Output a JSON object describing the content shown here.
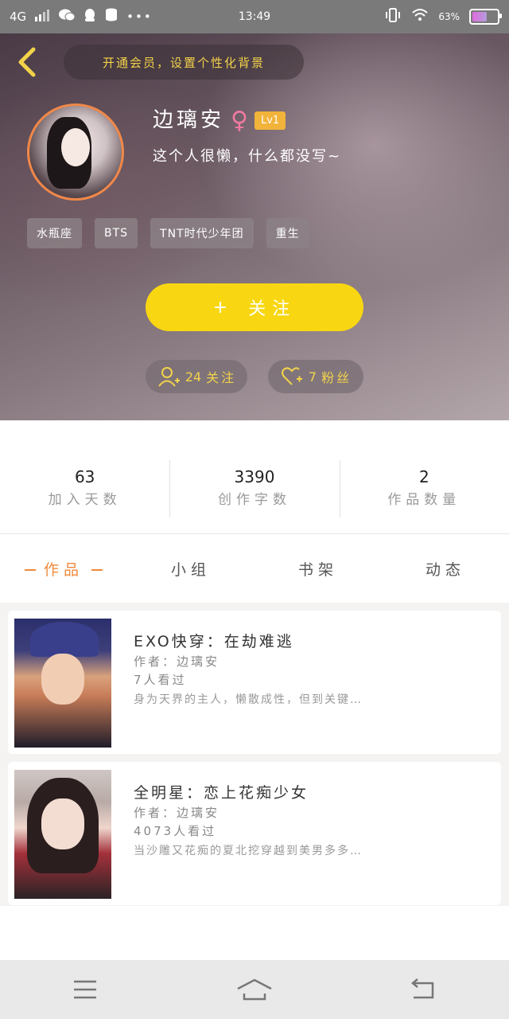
{
  "status_bar": {
    "network": "4G",
    "time": "13:49",
    "battery": "63%"
  },
  "header": {
    "vip_banner": "开通会员，设置个性化背景",
    "name": "边璃安",
    "gender_symbol": "♀",
    "level": "Lv1",
    "bio": "这个人很懒，什么都没写~",
    "tags": [
      "水瓶座",
      "BTS",
      "TNT时代少年团",
      "重生"
    ],
    "follow_button": {
      "plus": "+",
      "label": "关注"
    },
    "following": {
      "count": "24",
      "label": "关注"
    },
    "followers": {
      "count": "7",
      "label": "粉丝"
    }
  },
  "stats": [
    {
      "value": "63",
      "label": "加入天数"
    },
    {
      "value": "3390",
      "label": "创作字数"
    },
    {
      "value": "2",
      "label": "作品数量"
    }
  ],
  "tabs": {
    "works": "作品",
    "group": "小组",
    "shelf": "书架",
    "feed": "动态"
  },
  "works": [
    {
      "title": "EXO快穿：在劫难逃",
      "author": "作者：边璃安",
      "views": "7人看过",
      "desc": "身为天界的主人，懒散成性，但到关键…"
    },
    {
      "title": "全明星：恋上花痴少女",
      "author": "作者：边璃安",
      "views": "4073人看过",
      "desc": "当沙雕又花痴的夏北挖穿越到美男多多…"
    }
  ],
  "colors": {
    "accent_yellow": "#f8d712",
    "accent_orange": "#f08a3c",
    "gender_pink": "#f07aa0",
    "level_badge": "#f2b33a"
  },
  "icons": {
    "back": "chevron-left-icon",
    "follow_plus": "plus-icon",
    "following": "user-plus-icon",
    "followers": "heart-plus-icon",
    "nav_menu": "menu-icon",
    "nav_home": "home-icon",
    "nav_back": "back-arrow-icon"
  }
}
